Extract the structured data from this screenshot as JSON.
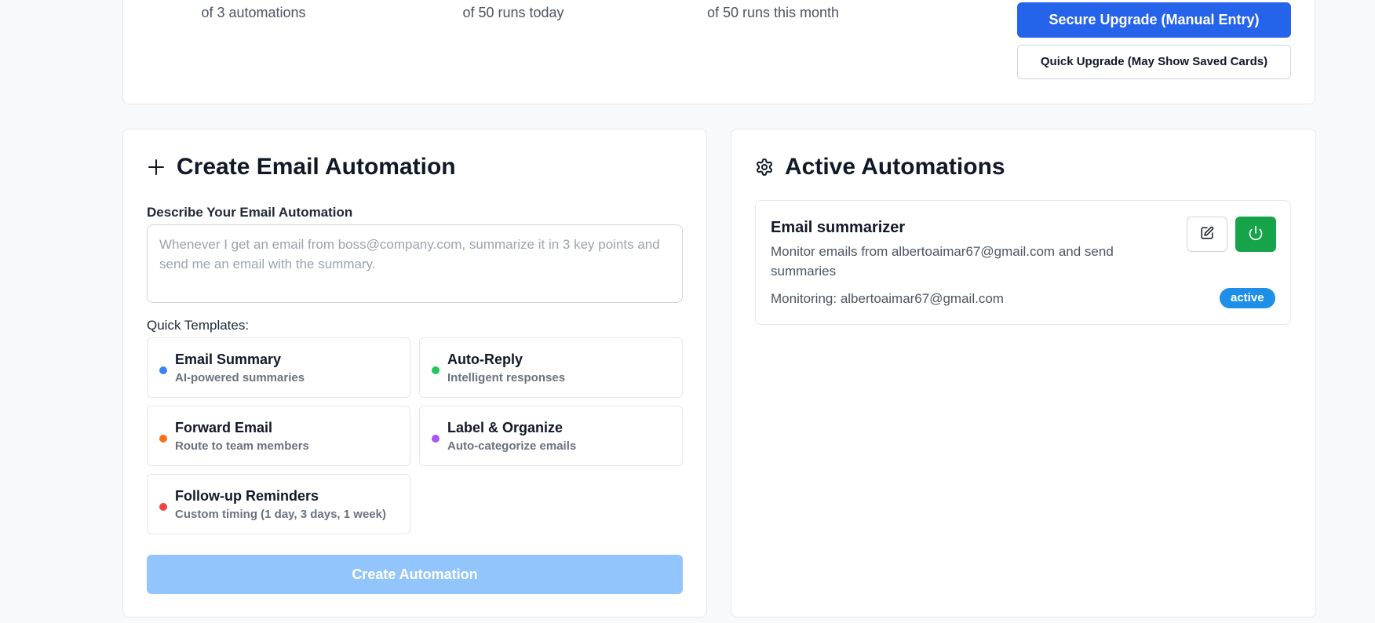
{
  "usage": {
    "automations_sub": "of 3 automations",
    "runs_today_sub": "of 50 runs today",
    "runs_month_sub": "of 50 runs this month",
    "secure_upgrade_label": "Secure Upgrade (Manual Entry)",
    "quick_upgrade_label": "Quick Upgrade (May Show Saved Cards)"
  },
  "create": {
    "title": "Create Email Automation",
    "icon": "plus-icon",
    "describe_label": "Describe Your Email Automation",
    "describe_placeholder": "Whenever I get an email from boss@company.com, summarize it in 3 key points and send me an email with the summary.",
    "templates_label": "Quick Templates:",
    "templates": [
      {
        "title": "Email Summary",
        "desc": "AI-powered summaries",
        "color": "#3b82f6"
      },
      {
        "title": "Auto-Reply",
        "desc": "Intelligent responses",
        "color": "#22c55e"
      },
      {
        "title": "Forward Email",
        "desc": "Route to team members",
        "color": "#f97316"
      },
      {
        "title": "Label & Organize",
        "desc": "Auto-categorize emails",
        "color": "#a855f7"
      },
      {
        "title": "Follow-up Reminders",
        "desc": "Custom timing (1 day, 3 days, 1 week)",
        "color": "#ef4444"
      }
    ],
    "create_button_label": "Create Automation"
  },
  "active": {
    "title": "Active Automations",
    "icon": "gear-icon",
    "items": [
      {
        "name": "Email summarizer",
        "description": "Monitor emails from albertoaimar67@gmail.com and send summaries",
        "monitoring": "Monitoring: albertoaimar67@gmail.com",
        "status": "active"
      }
    ]
  },
  "colors": {
    "primary": "#2563eb",
    "create_disabled": "#93c5fd",
    "power_green": "#16a34a",
    "status_badge": "#1d8fe8"
  }
}
